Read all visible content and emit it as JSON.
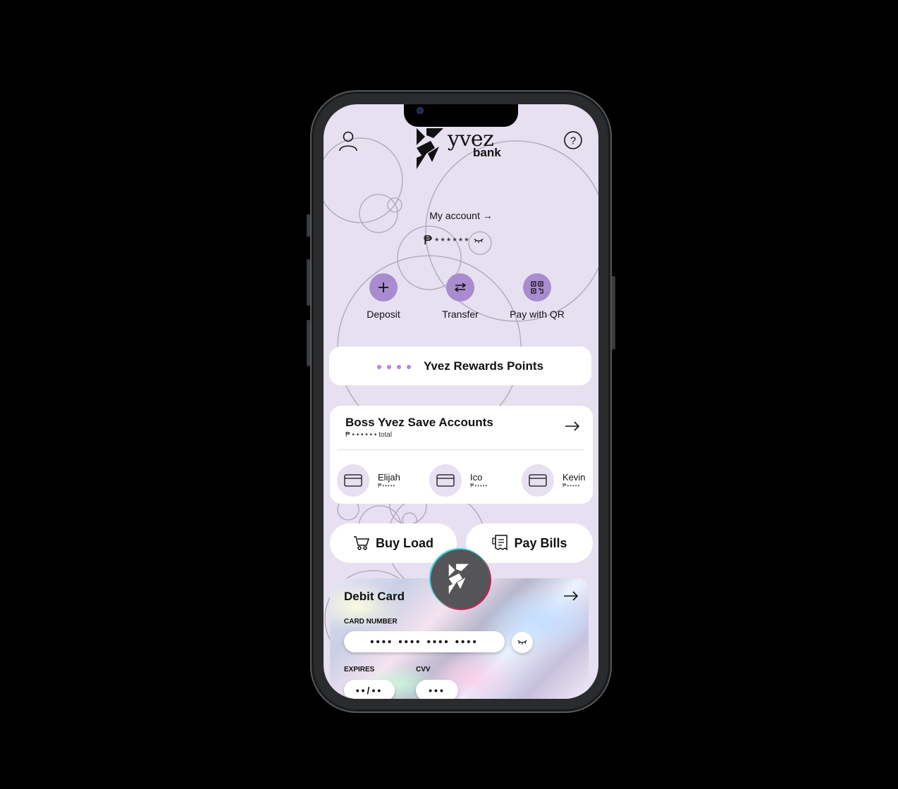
{
  "app": {
    "logo_word": "yvez",
    "logo_sub": "bank"
  },
  "header": {
    "profile_icon": "user-icon",
    "help_icon": "question-icon"
  },
  "account": {
    "my_account_label": "My account →",
    "currency": "₱",
    "balance_masked": "******"
  },
  "actions": [
    {
      "label": "Deposit",
      "icon": "plus-icon"
    },
    {
      "label": "Transfer",
      "icon": "swap-arrows-icon"
    },
    {
      "label": "Pay with QR",
      "icon": "qr-code-icon"
    }
  ],
  "rewards": {
    "title": "Yvez Rewards Points"
  },
  "save_accounts": {
    "title": "Boss Yvez Save Accounts",
    "total_masked": "₱ • • • • • •",
    "total_label": "total",
    "accounts": [
      {
        "name": "Elijah",
        "amount": "₱•••••"
      },
      {
        "name": "Ico",
        "amount": "₱•••••"
      },
      {
        "name": "Kevin",
        "amount": "₱•••••"
      }
    ]
  },
  "quick": {
    "buy_load": "Buy Load",
    "pay_bills": "Pay Bills"
  },
  "debit_card": {
    "title": "Debit Card",
    "card_number_label": "CARD NUMBER",
    "card_number_masked": "•••• •••• •••• ••••",
    "expires_label": "EXPIRES",
    "expires_masked": "••/••",
    "cvv_label": "CVV",
    "cvv_masked": "•••"
  },
  "colors": {
    "background": "#e6e0f1",
    "accent": "#a98bcf",
    "reward_dot": "#b583e8"
  }
}
